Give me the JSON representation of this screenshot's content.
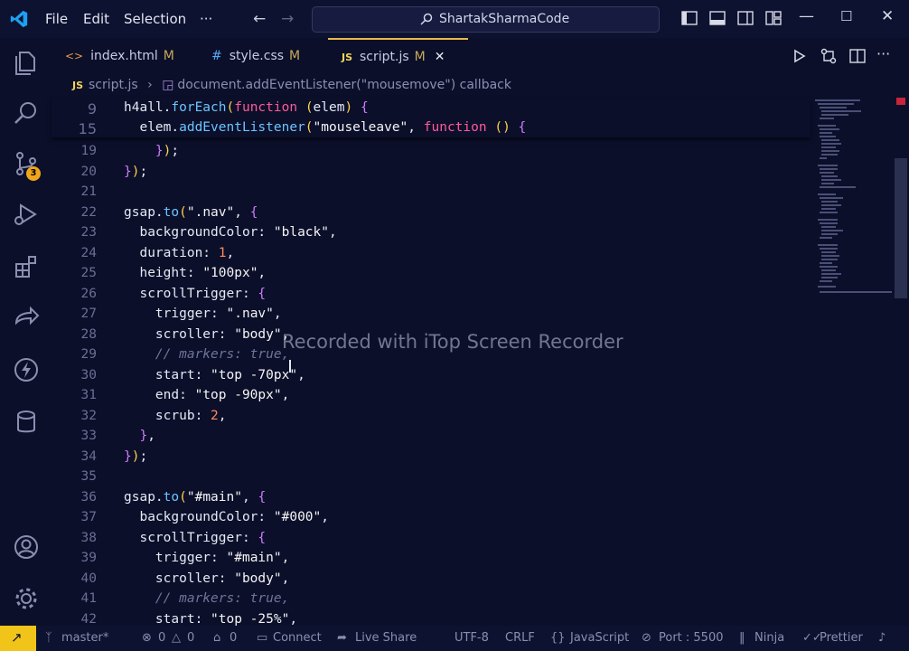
{
  "menu": [
    "File",
    "Edit",
    "Selection",
    "···"
  ],
  "search": {
    "label": "ShartakSharmaCode"
  },
  "tabs": [
    {
      "icon": "<>",
      "label": "index.html",
      "status": "M"
    },
    {
      "icon": "#",
      "label": "style.css",
      "status": "M"
    },
    {
      "icon": "JS",
      "label": "script.js",
      "status": "M"
    }
  ],
  "breadcrumb": {
    "file": "script.js",
    "symbol": "document.addEventListener(\"mousemove\") callback"
  },
  "scm_badge": "3",
  "sticky": [
    {
      "n": "9",
      "code": "h4all.forEach(function (elem) {"
    },
    {
      "n": "15",
      "code": "  elem.addEventListener(\"mouseleave\", function () {"
    }
  ],
  "lines": [
    {
      "n": "19",
      "code": "    });"
    },
    {
      "n": "20",
      "code": "});"
    },
    {
      "n": "21",
      "code": ""
    },
    {
      "n": "22",
      "code": "gsap.to(\".nav\", {"
    },
    {
      "n": "23",
      "code": "  backgroundColor: \"black\","
    },
    {
      "n": "24",
      "code": "  duration: 1,"
    },
    {
      "n": "25",
      "code": "  height: \"100px\","
    },
    {
      "n": "26",
      "code": "  scrollTrigger: {"
    },
    {
      "n": "27",
      "code": "    trigger: \".nav\","
    },
    {
      "n": "28",
      "code": "    scroller: \"body\","
    },
    {
      "n": "29",
      "code": "    // markers: true,"
    },
    {
      "n": "30",
      "code": "    start: \"top -70px\","
    },
    {
      "n": "31",
      "code": "    end: \"top -90px\","
    },
    {
      "n": "32",
      "code": "    scrub: 2,"
    },
    {
      "n": "33",
      "code": "  },"
    },
    {
      "n": "34",
      "code": "});"
    },
    {
      "n": "35",
      "code": ""
    },
    {
      "n": "36",
      "code": "gsap.to(\"#main\", {"
    },
    {
      "n": "37",
      "code": "  backgroundColor: \"#000\","
    },
    {
      "n": "38",
      "code": "  scrollTrigger: {"
    },
    {
      "n": "39",
      "code": "    trigger: \"#main\","
    },
    {
      "n": "40",
      "code": "    scroller: \"body\","
    },
    {
      "n": "41",
      "code": "    // markers: true,"
    },
    {
      "n": "42",
      "code": "    start: \"top -25%\","
    }
  ],
  "watermark": "Recorded with iTop Screen Recorder",
  "status": {
    "branch": "master*",
    "errors": "0",
    "warnings": "0",
    "ports": "0",
    "connect": "Connect",
    "live_share": "Live Share",
    "encoding": "UTF-8",
    "eol": "CRLF",
    "language": "JavaScript",
    "port": "Port : 5500",
    "ninja": "Ninja",
    "prettier": "Prettier"
  },
  "colors": {
    "accent": "#f0c419",
    "background": "#0b0f2a",
    "keyword": "#ff5a9a",
    "function": "#6cc4ff"
  }
}
